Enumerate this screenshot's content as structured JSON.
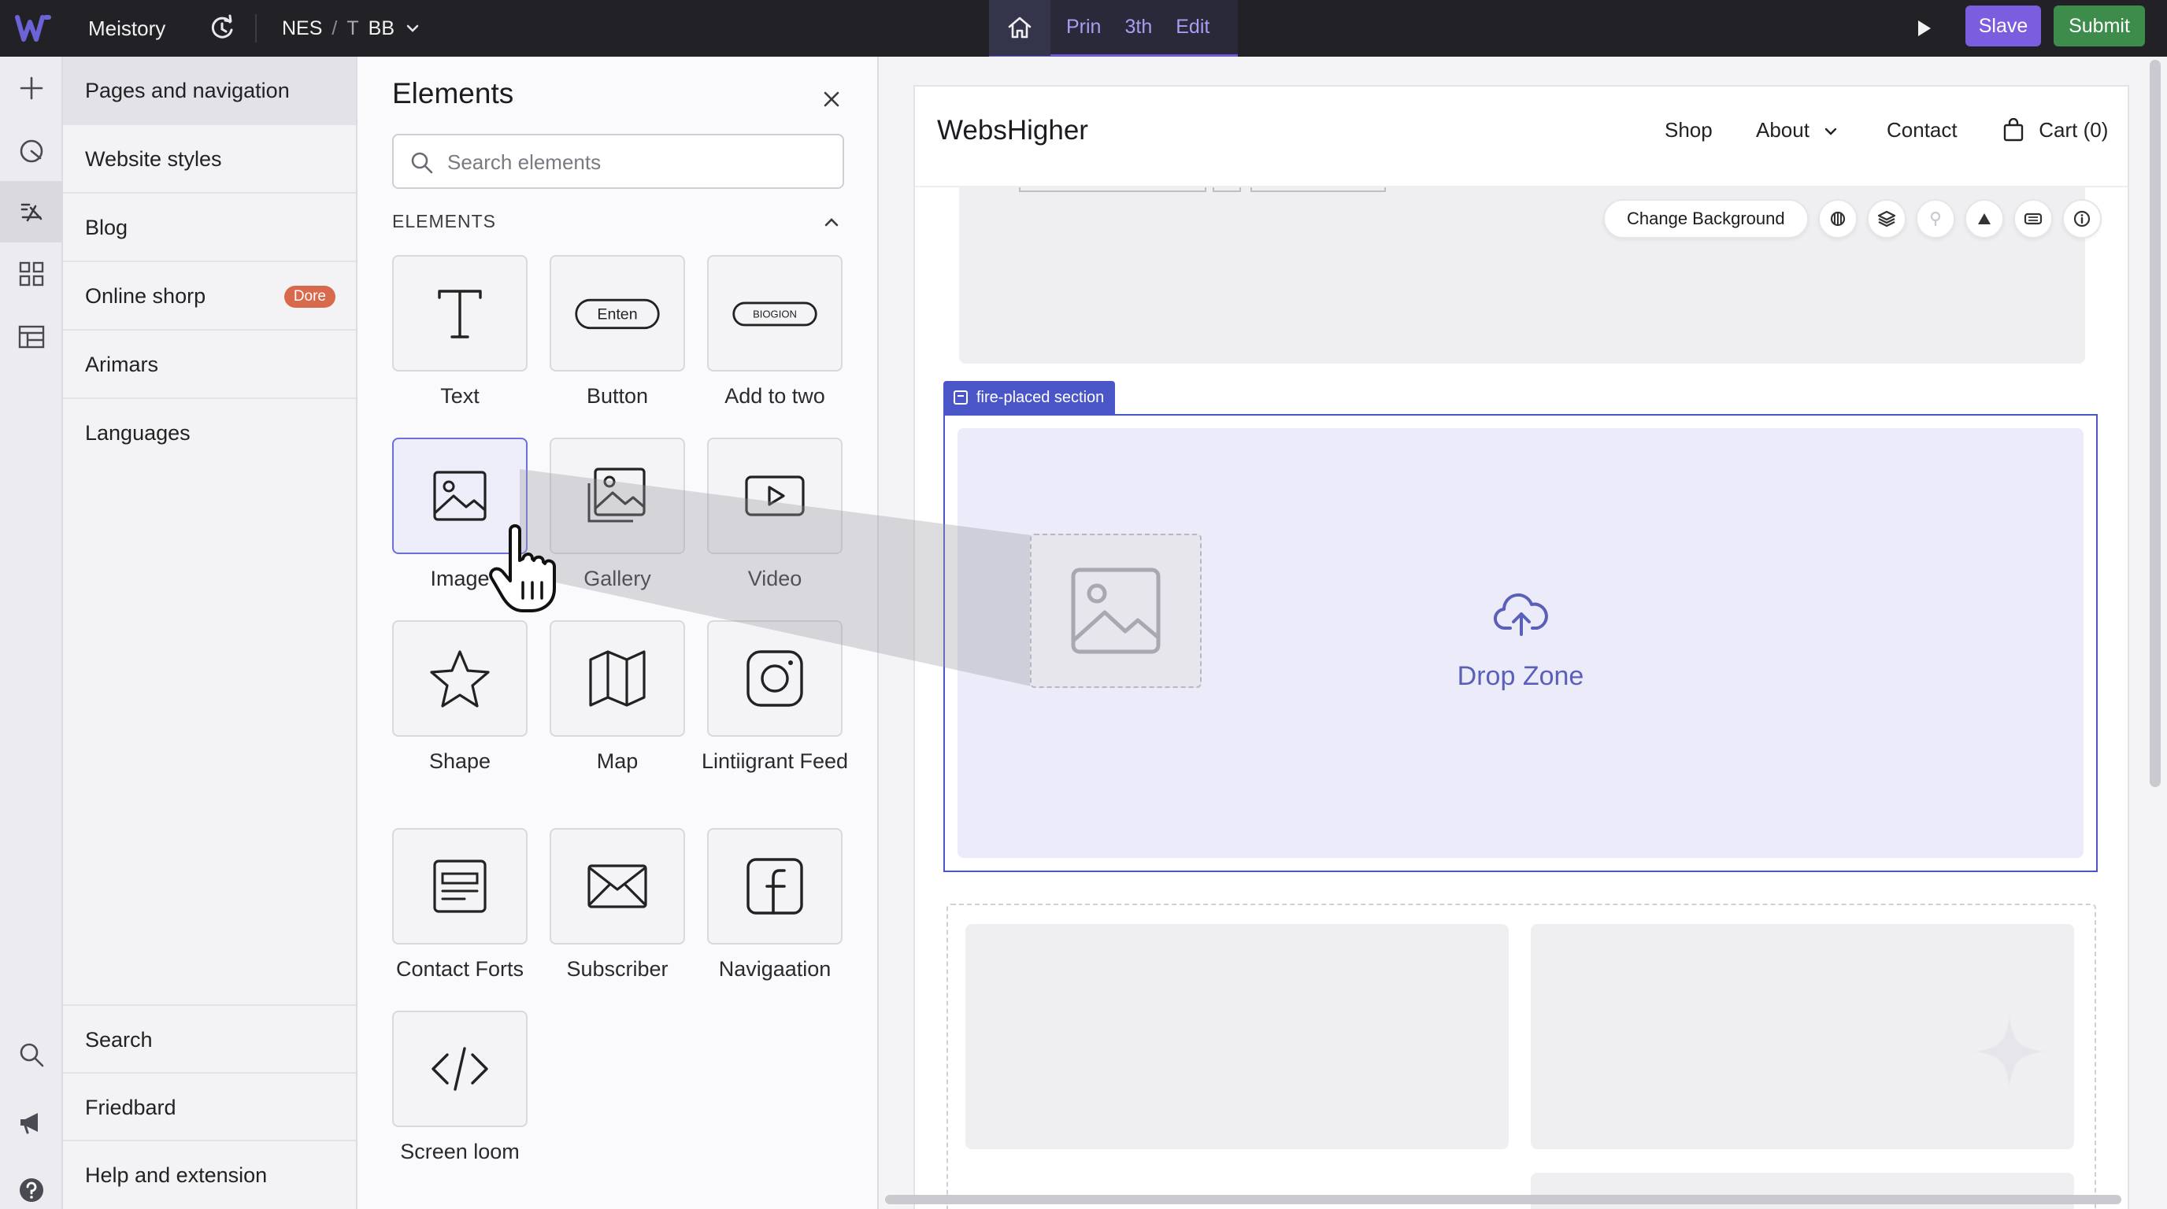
{
  "topbar": {
    "site_name": "Meistory",
    "breadcrumb": {
      "part1": "NES",
      "sep": "/",
      "part2": "T",
      "part3": "BB"
    },
    "mode_tabs": [
      "Prin",
      "3th",
      "Edit"
    ],
    "slave_label": "Slave",
    "submit_label": "Submit",
    "accent": "#7b5ee0",
    "submit_color": "#3d8c4c"
  },
  "pages_panel": {
    "items": [
      {
        "label": "Pages and navigation"
      },
      {
        "label": "Website styles"
      },
      {
        "label": "Blog"
      },
      {
        "label": "Online shorp",
        "badge": "Dore"
      },
      {
        "label": "Arimars"
      },
      {
        "label": "Languages"
      }
    ],
    "bottom": [
      {
        "label": "Search"
      },
      {
        "label": "Friedbard"
      },
      {
        "label": "Help and extension"
      }
    ]
  },
  "elements_panel": {
    "title": "Elements",
    "search_placeholder": "Search elements",
    "section": "ELEMENTS",
    "tiles": [
      {
        "label": "Text",
        "icon": "text-icon"
      },
      {
        "label": "Button",
        "icon": "button-icon",
        "glyph": "Enten"
      },
      {
        "label": "Add to two",
        "icon": "add-to-cart-icon",
        "glyph": "BIOGION"
      },
      {
        "label": "Image",
        "icon": "image-icon",
        "selected": true
      },
      {
        "label": "Gallery",
        "icon": "gallery-icon"
      },
      {
        "label": "Video",
        "icon": "video-icon"
      },
      {
        "label": "Shape",
        "icon": "star-icon"
      },
      {
        "label": "Map",
        "icon": "map-icon"
      },
      {
        "label": "Lintiigrant Feed",
        "icon": "instagram-icon"
      },
      {
        "label": "Contact Forts",
        "icon": "form-icon"
      },
      {
        "label": "Subscriber",
        "icon": "envelope-icon"
      },
      {
        "label": "Navigaation",
        "icon": "facebook-icon"
      },
      {
        "label": "Screen loom",
        "icon": "code-icon"
      }
    ]
  },
  "canvas": {
    "brand": "WebsHigher",
    "nav": {
      "shop": "Shop",
      "about": "About",
      "contact": "Contact",
      "cart": "Cart (0)"
    },
    "hero_toolbar": {
      "change_bg": "Change Background"
    },
    "section_tag": "fire-placed section",
    "drop_zone_label": "Drop Zone",
    "section_color": "#4a56c8"
  }
}
